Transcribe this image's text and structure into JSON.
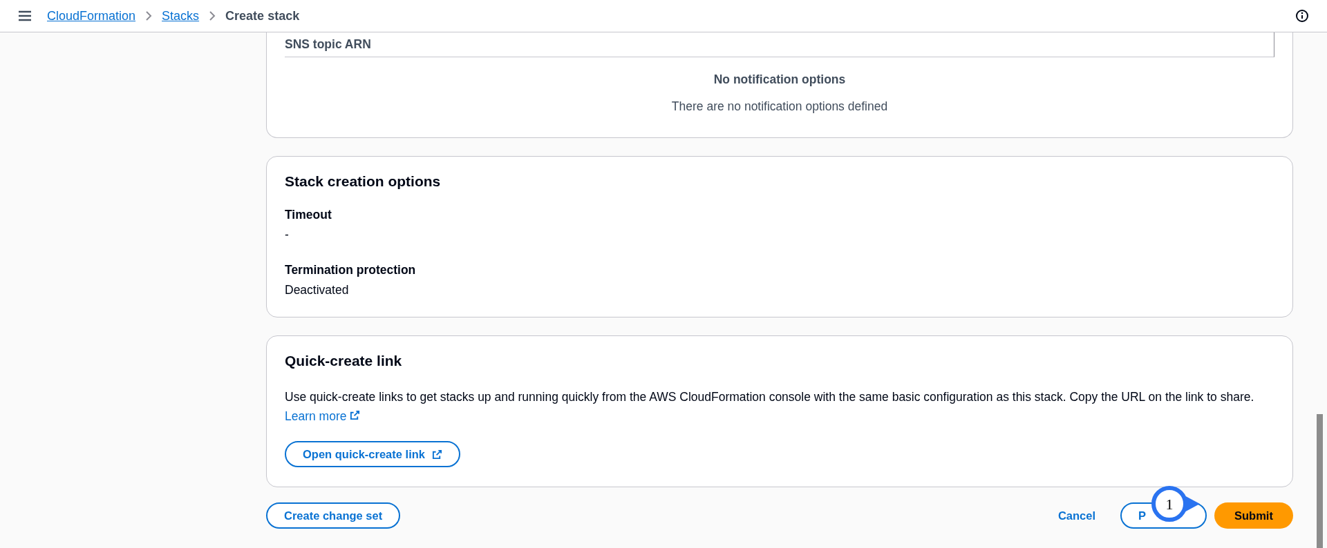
{
  "header": {
    "breadcrumbs": [
      {
        "label": "CloudFormation",
        "link": true
      },
      {
        "label": "Stacks",
        "link": true
      },
      {
        "label": "Create stack",
        "link": false
      }
    ]
  },
  "notifications": {
    "column": "SNS topic ARN",
    "empty_title": "No notification options",
    "empty_text": "There are no notification options defined"
  },
  "stack_creation_options": {
    "title": "Stack creation options",
    "fields": [
      {
        "label": "Timeout",
        "value": "-"
      },
      {
        "label": "Termination protection",
        "value": "Deactivated"
      }
    ]
  },
  "quick_create_link": {
    "title": "Quick-create link",
    "description": "Use quick-create links to get stacks up and running quickly from the AWS CloudFormation console with the same basic configuration as this stack. Copy the URL on the link to share.",
    "learn_more": "Learn more",
    "button": "Open quick-create link"
  },
  "footer": {
    "create_change_set": "Create change set",
    "cancel": "Cancel",
    "previous": "P",
    "submit": "Submit"
  },
  "step_marker": {
    "label": "1"
  }
}
